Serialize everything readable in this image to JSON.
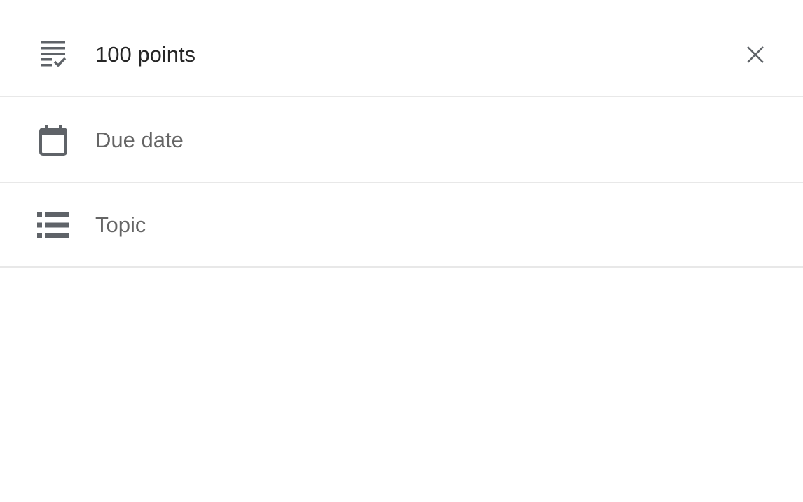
{
  "fields": {
    "points": {
      "value": "100 points",
      "icon": "grading-icon",
      "clear_icon": "close-icon"
    },
    "due_date": {
      "placeholder": "Due date",
      "icon": "calendar-icon"
    },
    "topic": {
      "placeholder": "Topic",
      "icon": "list-icon"
    }
  },
  "colors": {
    "icon": "#5f6368",
    "text": "#262626",
    "placeholder": "#656565",
    "divider": "#e8e8e8"
  }
}
